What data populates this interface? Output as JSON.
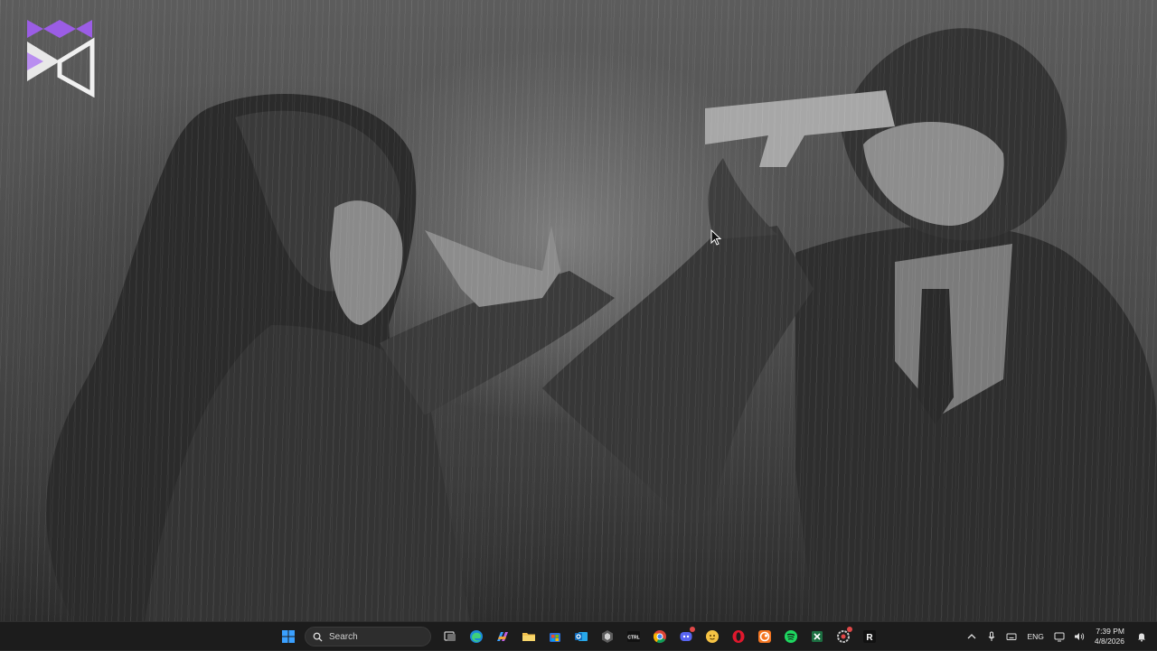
{
  "desktop": {
    "wallpaper": "anime-rain-wallpaper",
    "logo": "purple-white-m-logo",
    "accent_logo_color": "#9b5de5"
  },
  "taskbar": {
    "search_placeholder": "Search",
    "pinned_apps": [
      {
        "name": "start",
        "icon": "windows-logo-icon"
      },
      {
        "name": "task-view",
        "icon": "task-view-icon"
      },
      {
        "name": "edge",
        "icon": "edge-icon"
      },
      {
        "name": "copilot",
        "icon": "copilot-icon"
      },
      {
        "name": "file-explorer",
        "icon": "folder-icon"
      },
      {
        "name": "store",
        "icon": "store-icon"
      },
      {
        "name": "outlook",
        "icon": "outlook-icon"
      },
      {
        "name": "app-dark",
        "icon": "cube-icon"
      },
      {
        "name": "ctrl-app",
        "icon": "ctrl-icon",
        "label": "CTRL"
      },
      {
        "name": "chrome",
        "icon": "chrome-icon"
      },
      {
        "name": "discord",
        "icon": "discord-icon"
      },
      {
        "name": "yellow-app",
        "icon": "yellow-chat-icon"
      },
      {
        "name": "opera",
        "icon": "opera-icon"
      },
      {
        "name": "crunchyroll",
        "icon": "crunchyroll-icon"
      },
      {
        "name": "spotify",
        "icon": "spotify-icon"
      },
      {
        "name": "excel",
        "icon": "excel-icon"
      },
      {
        "name": "steelseries",
        "icon": "red-gear-icon"
      },
      {
        "name": "roblox",
        "icon": "r-icon",
        "label": "R"
      }
    ],
    "tray": {
      "language": "ENG",
      "time": "7:39 PM",
      "date": "4/8/2026"
    }
  }
}
